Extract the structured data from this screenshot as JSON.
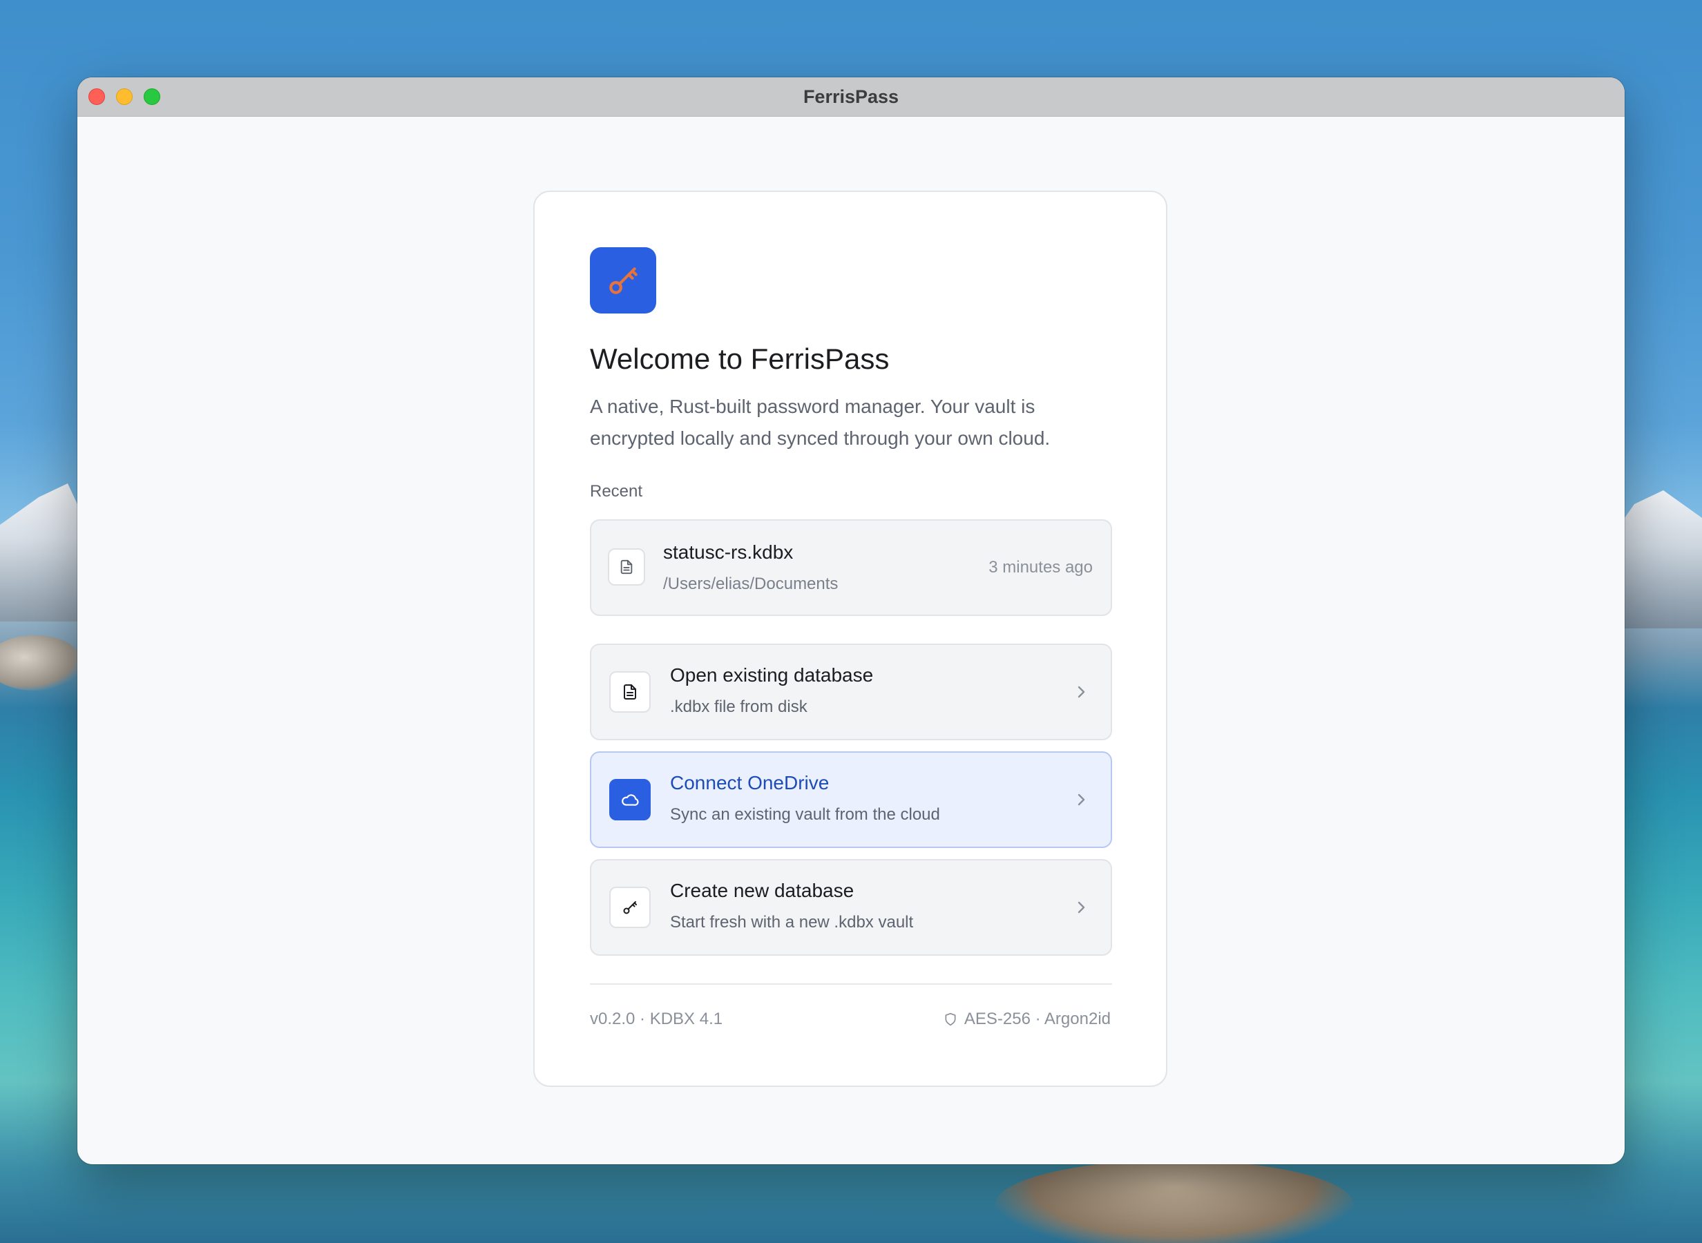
{
  "window": {
    "title": "FerrisPass"
  },
  "welcome": {
    "heading": "Welcome to FerrisPass",
    "description": "A native, Rust-built password manager. Your vault is encrypted locally and synced through your own cloud.",
    "recent_label": "Recent"
  },
  "recent": {
    "filename": "statusc-rs.kdbx",
    "path": "/Users/elias/Documents",
    "time": "3 minutes ago",
    "icon": "document-icon"
  },
  "actions": [
    {
      "title": "Open existing database",
      "subtitle": ".kdbx file from disk",
      "icon": "document-icon"
    },
    {
      "title": "Connect OneDrive",
      "subtitle": "Sync an existing vault from the cloud",
      "icon": "cloud-icon"
    },
    {
      "title": "Create new database",
      "subtitle": "Start fresh with a new .kdbx vault",
      "icon": "key-icon"
    }
  ],
  "footer": {
    "version": "v0.2.0 · KDBX 4.1",
    "crypto": "AES-256 · Argon2id",
    "icon": "shield-icon"
  },
  "colors": {
    "accent": "#2b5fe1",
    "key_orange": "#e8733a",
    "highlight_bg": "#eaf0fe",
    "highlight_text": "#1d4cb8"
  }
}
